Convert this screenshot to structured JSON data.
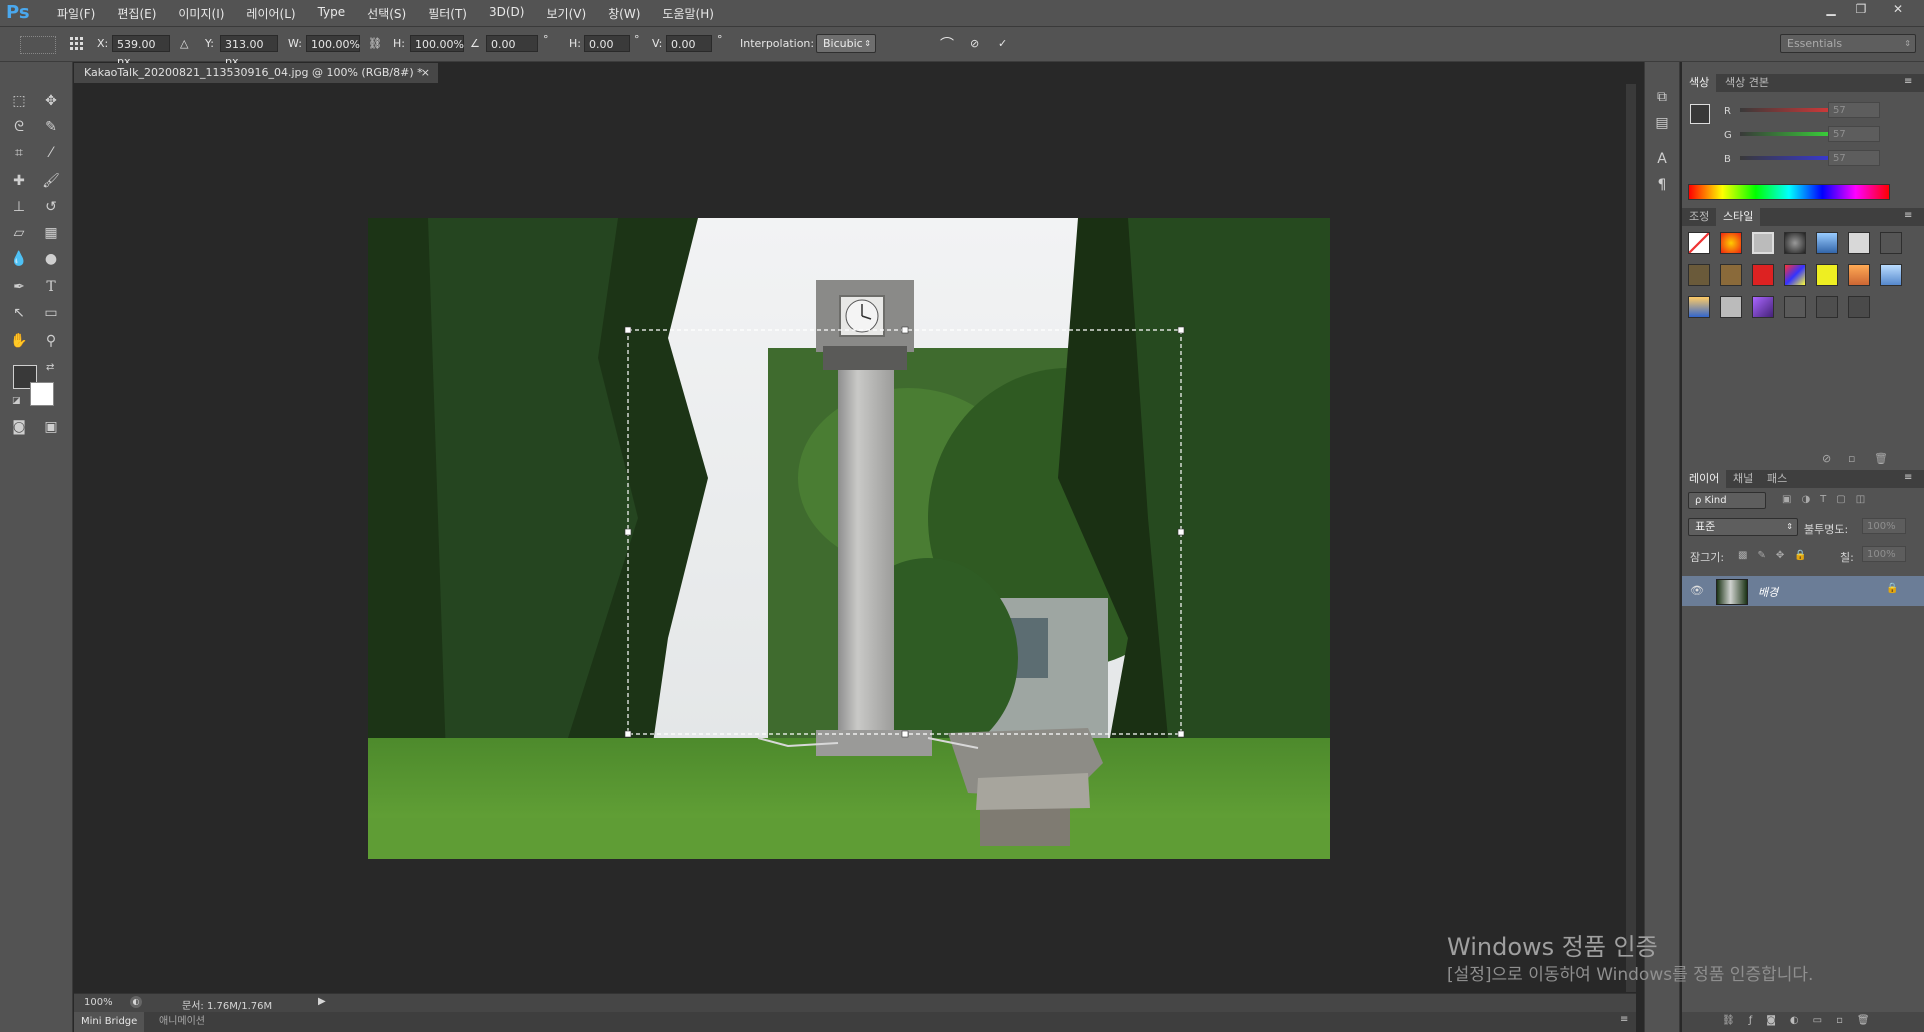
{
  "app": {
    "logo": "Ps"
  },
  "menu": [
    "파일(F)",
    "편집(E)",
    "이미지(I)",
    "레이어(L)",
    "Type",
    "선택(S)",
    "필터(T)",
    "3D(D)",
    "보기(V)",
    "창(W)",
    "도움말(H)"
  ],
  "window_controls": {
    "minimize": "▁",
    "restore": "❐",
    "close": "✕"
  },
  "options": {
    "x_label": "X:",
    "x_value": "539.00 px",
    "y_label": "Y:",
    "y_value": "313.00 px",
    "w_label": "W:",
    "w_value": "100.00%",
    "h_label": "H:",
    "h_value": "100.00%",
    "angle_value": "0.00",
    "hskew_label": "H:",
    "hskew_value": "0.00",
    "vskew_label": "V:",
    "vskew_value": "0.00",
    "degree": "°",
    "interp_label": "Interpolation:",
    "interp_value": "Bicubic",
    "workspace": "Essentials"
  },
  "document": {
    "tab_title": "KakaoTalk_20200821_113530916_04.jpg @ 100% (RGB/8#) *",
    "tab_close": "×"
  },
  "status": {
    "zoom": "100%",
    "doc_size": "문서: 1.76M/1.76M"
  },
  "bottom_tabs": [
    "Mini Bridge",
    "애니메이션"
  ],
  "color_panel": {
    "tabs": [
      "색상",
      "색상 견본"
    ],
    "r_label": "R",
    "g_label": "G",
    "b_label": "B",
    "r": "57",
    "g": "57",
    "b": "57"
  },
  "styles_panel": {
    "tabs": [
      "조정",
      "스타일"
    ]
  },
  "layers_panel": {
    "tabs": [
      "레이어",
      "채널",
      "패스"
    ],
    "filter": "ρ Kind",
    "blend_mode": "표준",
    "opacity_label": "불투명도:",
    "opacity": "100%",
    "lock_label": "잠그기:",
    "fill_label": "칠:",
    "fill": "100%",
    "layer_name": "배경"
  },
  "watermark": {
    "line1": "Windows 정품 인증",
    "line2": "[설정]으로 이동하여 Windows를 정품 인증합니다."
  },
  "colors": {
    "accent": "#4aa8ee",
    "ui_bg": "#535353",
    "canvas_bg": "#282828",
    "selected_layer": "#6b7d97"
  }
}
